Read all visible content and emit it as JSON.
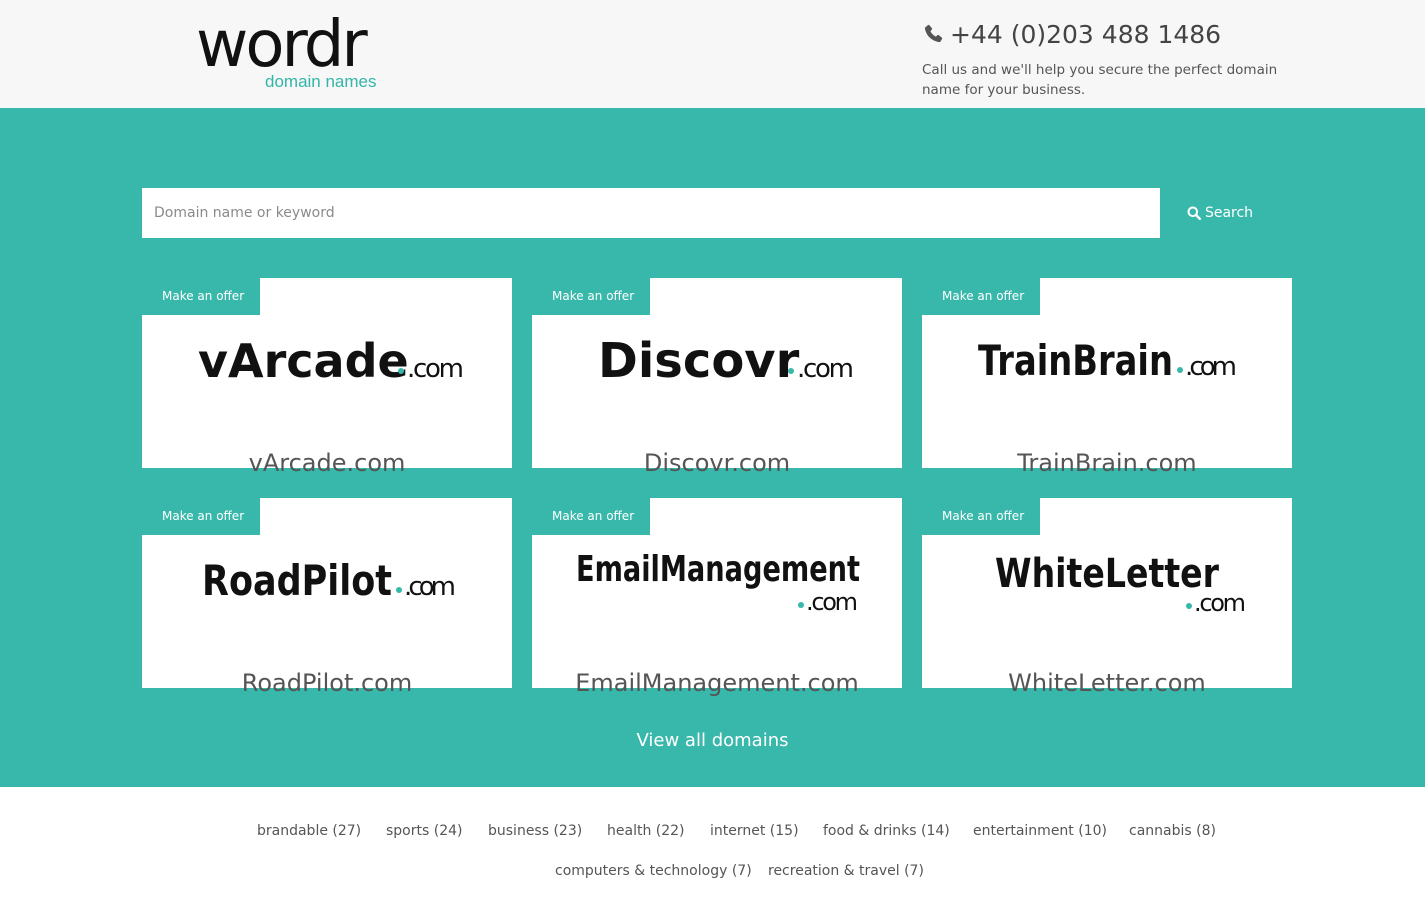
{
  "header": {
    "logo_word": "wordr",
    "logo_sub": "domain names",
    "phone": "+44 (0)203 488 1486",
    "contact_text": "Call us and we'll help you secure the perfect domain name for your business."
  },
  "search": {
    "placeholder": "Domain name or keyword",
    "button_label": "Search"
  },
  "colors": {
    "accent": "#38b8ab",
    "header_bg": "#f7f7f7",
    "logo_text": "#111111"
  },
  "cards": [
    {
      "offer_label": "Make an offer",
      "logo_main": "vArcade",
      "logo_tld": ".com",
      "name": "vArcade.com"
    },
    {
      "offer_label": "Make an offer",
      "logo_main": "Discovr",
      "logo_tld": ".com",
      "name": "Discovr.com"
    },
    {
      "offer_label": "Make an offer",
      "logo_main": "TrainBrain",
      "logo_tld": ".com",
      "name": "TrainBrain.com"
    },
    {
      "offer_label": "Make an offer",
      "logo_main": "RoadPilot",
      "logo_tld": ".com",
      "name": "RoadPilot.com"
    },
    {
      "offer_label": "Make an offer",
      "logo_main": "EmailManagement",
      "logo_tld": ".com",
      "name": "EmailManagement.com"
    },
    {
      "offer_label": "Make an offer",
      "logo_main": "WhiteLetter",
      "logo_tld": ".com",
      "name": "WhiteLetter.com"
    }
  ],
  "view_all_label": "View all domains",
  "tags": [
    "brandable (27)",
    "sports (24)",
    "business (23)",
    "health (22)",
    "internet (15)",
    "food & drinks (14)",
    "entertainment (10)",
    "cannabis (8)",
    "computers & technology (7)",
    "recreation & travel (7)"
  ]
}
